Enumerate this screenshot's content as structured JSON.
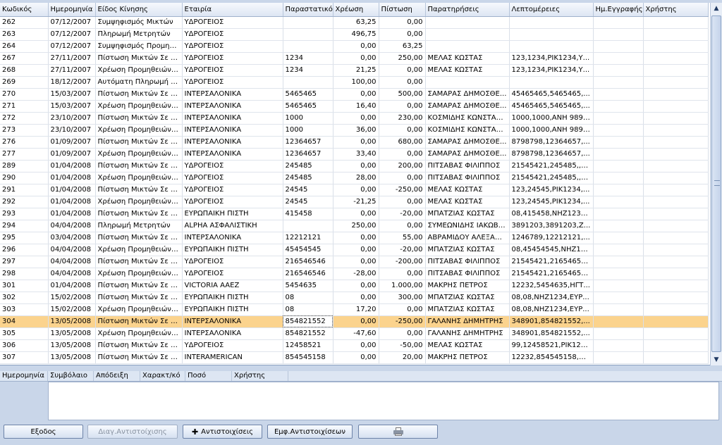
{
  "grid": {
    "columns": [
      "Κωδικός",
      "Ημερομηνία",
      "Είδος Κίνησης",
      "Εταιρία",
      "Παραστατικό",
      "Χρέωση",
      "Πίστωση",
      "Παρατηρήσεις",
      "Λεπτομέρειες",
      "Ημ.Εγγραφής",
      "Χρήστης"
    ],
    "rows": [
      [
        "262",
        "07/12/2007",
        "Συμψηφισμός Μικτών",
        "ΥΔΡΟΓΕΙΟΣ",
        "",
        "63,25",
        "0,00",
        "",
        "",
        "",
        ""
      ],
      [
        "263",
        "07/12/2007",
        "Πληρωμή Μετρητών",
        "ΥΔΡΟΓΕΙΟΣ",
        "",
        "496,75",
        "0,00",
        "",
        "",
        "",
        ""
      ],
      [
        "264",
        "07/12/2007",
        "Συμψηφισμός Προμηθε...",
        "ΥΔΡΟΓΕΙΟΣ",
        "",
        "0,00",
        "63,25",
        "",
        "",
        "",
        ""
      ],
      [
        "267",
        "27/11/2007",
        "Πίστωση Μικτών Σε Ετ...",
        "ΥΔΡΟΓΕΙΟΣ",
        "1234",
        "0,00",
        "250,00",
        "ΜΕΛΑΣ ΚΩΣΤΑΣ",
        "123,1234,ΡΙΚ1234,Υ...",
        "",
        ""
      ],
      [
        "268",
        "27/11/2007",
        "Χρέωση Προμηθειών Σ...",
        "ΥΔΡΟΓΕΙΟΣ",
        "1234",
        "21,25",
        "0,00",
        "ΜΕΛΑΣ ΚΩΣΤΑΣ",
        "123,1234,ΡΙΚ1234,Υ...",
        "",
        ""
      ],
      [
        "269",
        "18/12/2007",
        "Αυτόματη Πληρωμή Α...",
        "ΥΔΡΟΓΕΙΟΣ",
        "",
        "100,00",
        "0,00",
        "",
        "",
        "",
        ""
      ],
      [
        "270",
        "15/03/2007",
        "Πίστωση Μικτών Σε Ετ...",
        "ΙΝΤΕΡΣΑΛΟΝΙΚΑ",
        "5465465",
        "0,00",
        "500,00",
        "ΣΑΜΑΡΑΣ ΔΗΜΟΣΘΕ...",
        "45465465,5465465,...",
        "",
        ""
      ],
      [
        "271",
        "15/03/2007",
        "Χρέωση Προμηθειών Σ...",
        "ΙΝΤΕΡΣΑΛΟΝΙΚΑ",
        "5465465",
        "16,40",
        "0,00",
        "ΣΑΜΑΡΑΣ ΔΗΜΟΣΘΕ...",
        "45465465,5465465,...",
        "",
        ""
      ],
      [
        "272",
        "23/10/2007",
        "Πίστωση Μικτών Σε Ετ...",
        "ΙΝΤΕΡΣΑΛΟΝΙΚΑ",
        "1000",
        "0,00",
        "230,00",
        "ΚΟΣΜΙΔΗΣ ΚΩΝΣΤΑΝ...",
        "1000,1000,ΑΝΗ 9897...",
        "",
        ""
      ],
      [
        "273",
        "23/10/2007",
        "Χρέωση Προμηθειών Σ...",
        "ΙΝΤΕΡΣΑΛΟΝΙΚΑ",
        "1000",
        "36,00",
        "0,00",
        "ΚΟΣΜΙΔΗΣ ΚΩΝΣΤΑΝ...",
        "1000,1000,ΑΝΗ 9897...",
        "",
        ""
      ],
      [
        "276",
        "01/09/2007",
        "Πίστωση Μικτών Σε Ετ...",
        "ΙΝΤΕΡΣΑΛΟΝΙΚΑ",
        "12364657",
        "0,00",
        "680,00",
        "ΣΑΜΑΡΑΣ ΔΗΜΟΣΘΕ...",
        "8798798,12364657,...",
        "",
        ""
      ],
      [
        "277",
        "01/09/2007",
        "Χρέωση Προμηθειών Σ...",
        "ΙΝΤΕΡΣΑΛΟΝΙΚΑ",
        "12364657",
        "33,40",
        "0,00",
        "ΣΑΜΑΡΑΣ ΔΗΜΟΣΘΕ...",
        "8798798,12364657,...",
        "",
        ""
      ],
      [
        "289",
        "01/04/2008",
        "Πίστωση Μικτών Σε Ετ...",
        "ΥΔΡΟΓΕΙΟΣ",
        "245485",
        "0,00",
        "200,00",
        "ΠΙΤΣΑΒΑΣ ΦΙΛΙΠΠΟΣ",
        "21545421,245485,,Υ...",
        "",
        ""
      ],
      [
        "290",
        "01/04/2008",
        "Χρέωση Προμηθειών Σ...",
        "ΥΔΡΟΓΕΙΟΣ",
        "245485",
        "28,00",
        "0,00",
        "ΠΙΤΣΑΒΑΣ ΦΙΛΙΠΠΟΣ",
        "21545421,245485,,Υ...",
        "",
        ""
      ],
      [
        "291",
        "01/04/2008",
        "Πίστωση Μικτών Σε Ετ...",
        "ΥΔΡΟΓΕΙΟΣ",
        "24545",
        "0,00",
        "-250,00",
        "ΜΕΛΑΣ ΚΩΣΤΑΣ",
        "123,24545,ΡΙΚ1234,...",
        "",
        ""
      ],
      [
        "292",
        "01/04/2008",
        "Χρέωση Προμηθειών Σ...",
        "ΥΔΡΟΓΕΙΟΣ",
        "24545",
        "-21,25",
        "0,00",
        "ΜΕΛΑΣ ΚΩΣΤΑΣ",
        "123,24545,ΡΙΚ1234,...",
        "",
        ""
      ],
      [
        "293",
        "01/04/2008",
        "Πίστωση Μικτών Σε Ετ...",
        "ΕΥΡΩΠΑΙΚΗ ΠΙΣΤΗ",
        "415458",
        "0,00",
        "-20,00",
        "ΜΠΑΤΖΙΑΣ ΚΩΣΤΑΣ",
        "08,415458,ΝΗΖ1234,...",
        "",
        ""
      ],
      [
        "294",
        "04/04/2008",
        "Πληρωμή Μετρητών",
        "ALPHA ΑΣΦΑΛΙΣΤΙΚΗ",
        "",
        "250,00",
        "0,00",
        "ΣΥΜΕΩΝΙΔΗΣ ΙΑΚΩΒΟΣ",
        "3891203,3891203,Ζ...",
        "",
        ""
      ],
      [
        "295",
        "03/04/2008",
        "Πίστωση Μικτών Σε Ετ...",
        "ΙΝΤΕΡΣΑΛΟΝΙΚΑ",
        "12212121",
        "0,00",
        "55,00",
        "ΑΒΡΑΜΙΔΟΥ ΑΛΕΞΑΝ...",
        "1246789,12212121,...",
        "",
        ""
      ],
      [
        "296",
        "04/04/2008",
        "Χρέωση Προμηθειών Σ...",
        "ΕΥΡΩΠΑΙΚΗ ΠΙΣΤΗ",
        "45454545",
        "0,00",
        "-20,00",
        "ΜΠΑΤΖΙΑΣ ΚΩΣΤΑΣ",
        "08,45454545,ΝΗΖ12...",
        "",
        ""
      ],
      [
        "297",
        "04/04/2008",
        "Πίστωση Μικτών Σε Ετ...",
        "ΥΔΡΟΓΕΙΟΣ",
        "216546546",
        "0,00",
        "-200,00",
        "ΠΙΤΣΑΒΑΣ ΦΙΛΙΠΠΟΣ",
        "21545421,21654654...",
        "",
        ""
      ],
      [
        "298",
        "04/04/2008",
        "Χρέωση Προμηθειών Σ...",
        "ΥΔΡΟΓΕΙΟΣ",
        "216546546",
        "-28,00",
        "0,00",
        "ΠΙΤΣΑΒΑΣ ΦΙΛΙΠΠΟΣ",
        "21545421,21654654...",
        "",
        ""
      ],
      [
        "301",
        "01/04/2008",
        "Πίστωση Μικτών Σε Ετ...",
        "VICTORIA AAEZ",
        "5454635",
        "0,00",
        "1.000,00",
        "ΜΑΚΡΗΣ ΠΕΤΡΟΣ",
        "12232,5454635,ΗΓΤ...",
        "",
        ""
      ],
      [
        "302",
        "15/02/2008",
        "Πίστωση Μικτών Σε Ετ...",
        "ΕΥΡΩΠΑΙΚΗ ΠΙΣΤΗ",
        "08",
        "0,00",
        "300,00",
        "ΜΠΑΤΖΙΑΣ ΚΩΣΤΑΣ",
        "08,08,ΝΗΖ1234,ΕΥΡ...",
        "",
        ""
      ],
      [
        "303",
        "15/02/2008",
        "Χρέωση Προμηθειών Σ...",
        "ΕΥΡΩΠΑΙΚΗ ΠΙΣΤΗ",
        "08",
        "17,20",
        "0,00",
        "ΜΠΑΤΖΙΑΣ ΚΩΣΤΑΣ",
        "08,08,ΝΗΖ1234,ΕΥΡ...",
        "",
        ""
      ],
      [
        "304",
        "13/05/2008",
        "Πίστωση Μικτών Σε Ετ...",
        "ΙΝΤΕΡΣΑΛΟΝΙΚΑ",
        "854821552",
        "0,00",
        "-250,00",
        "ΓΑΛΑΝΗΣ ΔΗΜΗΤΡΗΣ",
        "348901,854821552,...",
        "",
        ""
      ],
      [
        "305",
        "13/05/2008",
        "Χρέωση Προμηθειών Σ...",
        "ΙΝΤΕΡΣΑΛΟΝΙΚΑ",
        "854821552",
        "-47,60",
        "0,00",
        "ΓΑΛΑΝΗΣ ΔΗΜΗΤΡΗΣ",
        "348901,854821552,...",
        "",
        ""
      ],
      [
        "306",
        "13/05/2008",
        "Πίστωση Μικτών Σε Ετ...",
        "ΥΔΡΟΓΕΙΟΣ",
        "12458521",
        "0,00",
        "-50,00",
        "ΜΕΛΑΣ ΚΩΣΤΑΣ",
        "99,12458521,ΡΙΚ123...",
        "",
        ""
      ],
      [
        "307",
        "13/05/2008",
        "Πίστωση Μικτών Σε Ετ...",
        "INTERAMERICAN",
        "854545158",
        "0,00",
        "20,00",
        "ΜΑΚΡΗΣ ΠΕΤΡΟΣ",
        "12232,854545158,Η...",
        "",
        ""
      ]
    ],
    "selected_code": "304"
  },
  "detail": {
    "columns": [
      "Ημερομηνία",
      "Συμβόλαιο",
      "Απόδειξη",
      "Χαρακτ/κό",
      "Ποσό",
      "Χρήστης"
    ]
  },
  "buttons": {
    "exit": "Εξοδος",
    "delete_match": "Διαγ.Αντιστοίχισης",
    "matches": "Αντιστοιχίσεις",
    "show_matches": "Εμφ.Αντιστοιχίσεων"
  },
  "icons": {
    "plus": "plus-icon",
    "print": "printer-icon"
  },
  "colors": {
    "selected_row": "#fbd38d",
    "background": "#c9d6e9"
  }
}
